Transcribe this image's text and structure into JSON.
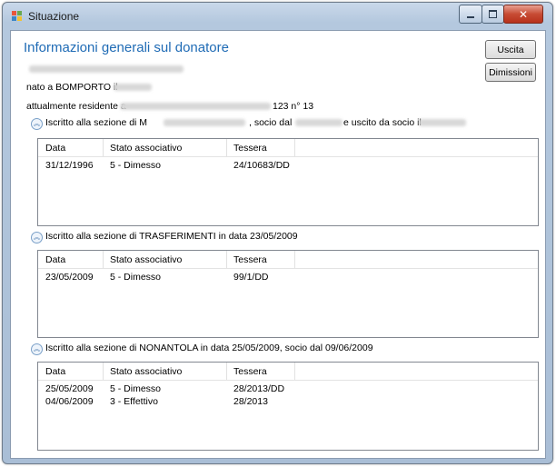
{
  "window": {
    "title": "Situazione"
  },
  "heading": "Informazioni generali sul donatore",
  "donor": {
    "born_label": "nato a BOMPORTO il",
    "residence_label": "attualmente residente a",
    "residence_suffix": "123 n° 13"
  },
  "buttons": {
    "uscita": "Uscita",
    "dimissioni": "Dimissioni"
  },
  "columns": [
    "Data",
    "Stato associativo",
    "Tessera"
  ],
  "sections": [
    {
      "caption_a": "Iscritto alla sezione di M",
      "caption_b": ", socio dal",
      "caption_c": "e uscito da socio il",
      "rows": [
        {
          "data": "31/12/1996",
          "stato": "5 - Dimesso",
          "tessera": "24/10683/DD"
        }
      ]
    },
    {
      "caption": "Iscritto alla sezione di TRASFERIMENTI in data 23/05/2009",
      "rows": [
        {
          "data": "23/05/2009",
          "stato": "5 - Dimesso",
          "tessera": "99/1/DD"
        }
      ]
    },
    {
      "caption": "Iscritto alla sezione di NONANTOLA in data 25/05/2009, socio dal 09/06/2009",
      "rows": [
        {
          "data": "25/05/2009",
          "stato": "5 - Dimesso",
          "tessera": "28/2013/DD"
        },
        {
          "data": "04/06/2009",
          "stato": "3 - Effettivo",
          "tessera": "28/2013"
        }
      ]
    }
  ]
}
